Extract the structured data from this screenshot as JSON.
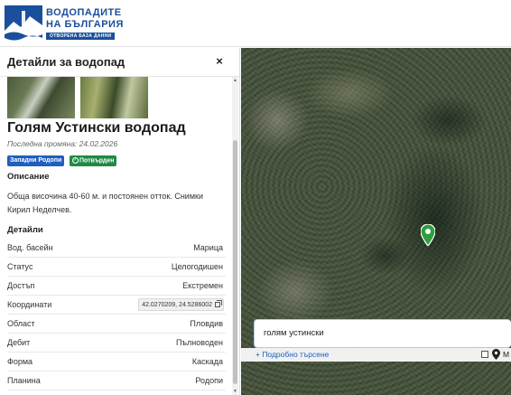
{
  "header": {
    "logo_line1": "ВОДОПАДИТЕ",
    "logo_line2": "НА БЪЛГАРИЯ",
    "logo_sub": "ОТВОРЕНА БАЗА ДАННИ"
  },
  "panel": {
    "title": "Детайли за водопад",
    "close_label": "×",
    "name": "Голям Устински водопад",
    "last_change": "Последна промяна: 24.02.2026",
    "badge_region": "Западни Родопи",
    "badge_confirmed": "Потвърден",
    "description_heading": "Описание",
    "description": "Обща височина 40-60 м. и постоянен отток. Снимки Кирил Неделчев.",
    "details_heading": "Детайли",
    "details": [
      {
        "label": "Вод. басейн",
        "value": "Марица"
      },
      {
        "label": "Статус",
        "value": "Целогодишен"
      },
      {
        "label": "Достъп",
        "value": "Екстремен"
      },
      {
        "label": "Координати",
        "value": "42.0270209, 24.5286002"
      },
      {
        "label": "Област",
        "value": "Пловдив"
      },
      {
        "label": "Дебит",
        "value": "Пълноводен"
      },
      {
        "label": "Форма",
        "value": "Каскада"
      },
      {
        "label": "Планина",
        "value": "Родопи"
      }
    ]
  },
  "search": {
    "value": "голям устински",
    "advanced_label": "+ Подробно търсене",
    "cut_label": "М"
  },
  "colors": {
    "brand": "#1a4f9c",
    "badge_region": "#1f5fc0",
    "badge_confirmed": "#1f8a45",
    "marker": "#2e9e3e"
  }
}
